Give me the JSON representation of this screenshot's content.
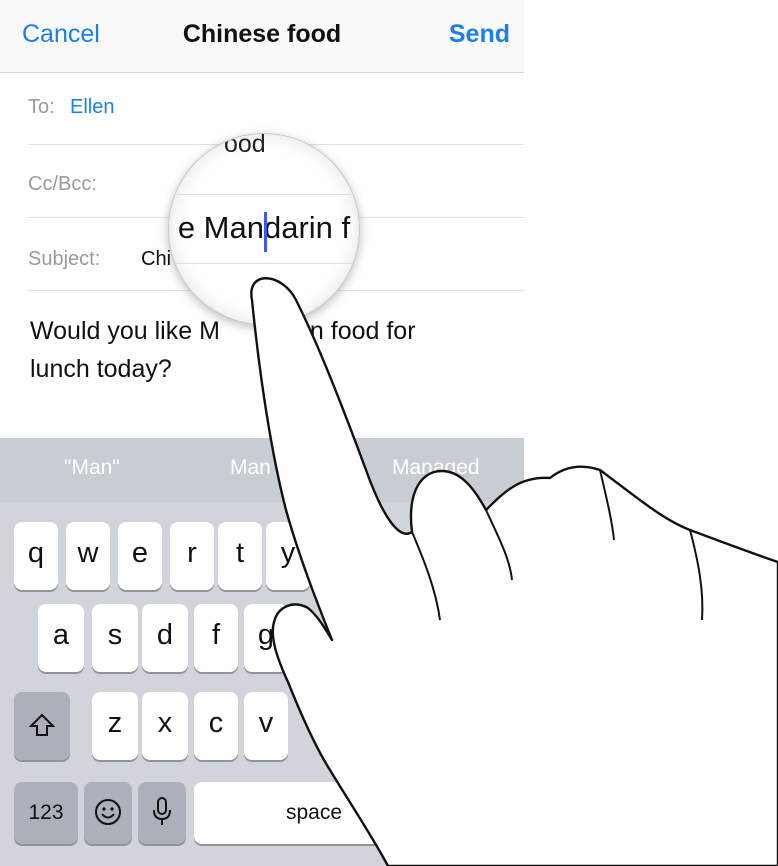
{
  "navbar": {
    "cancel_label": "Cancel",
    "title": "Chinese food",
    "send_label": "Send"
  },
  "fields": {
    "to_label": "To:",
    "to_value": "Ellen",
    "cc_label": "Cc/Bcc:",
    "subject_label": "Subject:",
    "subject_value": "Chi"
  },
  "body": {
    "line1_a": "Would you like M",
    "line1_b": "n food for",
    "line2": "lunch today?"
  },
  "magnifier": {
    "above_text": "ood",
    "text": "e Mandarin f"
  },
  "predictive": {
    "items": [
      "\"Man\"",
      "Man",
      "Managed"
    ]
  },
  "keyboard": {
    "row1": [
      "q",
      "w",
      "e",
      "r",
      "t",
      "y"
    ],
    "row2": [
      "a",
      "s",
      "d",
      "f",
      "g"
    ],
    "row3": [
      "z",
      "x",
      "c",
      "v"
    ],
    "numbers_label": "123",
    "space_label": "space",
    "shift_icon": "shift-arrow",
    "emoji_icon": "smiley",
    "mic_icon": "microphone"
  },
  "colors": {
    "accent": "#1a7ef0",
    "keyboard_bg": "#d1d4da",
    "caret": "#3b5bf0"
  }
}
